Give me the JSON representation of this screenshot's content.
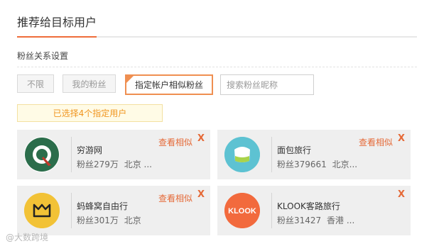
{
  "header": {
    "title": "推荐给目标用户"
  },
  "section": {
    "label": "粉丝关系设置"
  },
  "filters": {
    "unlimited": "不限",
    "my_fans": "我的粉丝",
    "similar_fans": "指定帐户相似粉丝",
    "search_placeholder": "搜索粉丝昵称"
  },
  "notice": {
    "text": "已选择4个指定用户"
  },
  "cards": [
    {
      "name": "穷游网",
      "fans": "粉丝279万",
      "location": "北京 ...",
      "similar_label": "查看相似",
      "close": "X",
      "avatar": "qyer-icon",
      "color": "#2b6d4b"
    },
    {
      "name": "面包旅行",
      "fans": "粉丝379661",
      "location": "北京...",
      "similar_label": "查看相似",
      "close": "X",
      "avatar": "bread-trip-icon",
      "color": "#5dc2d2"
    },
    {
      "name": "蚂蜂窝自由行",
      "fans": "粉丝301万",
      "location": "北京",
      "similar_label": "查看相似",
      "close": "X",
      "avatar": "mafengwo-icon",
      "color": "#f2c236"
    },
    {
      "name": "KLOOK客路旅行",
      "fans": "粉丝31427",
      "location": "香港 ...",
      "similar_label": "",
      "close": "X",
      "avatar": "klook-icon",
      "color": "#f26a3d"
    }
  ],
  "watermark": {
    "text": "@大数跨境"
  }
}
